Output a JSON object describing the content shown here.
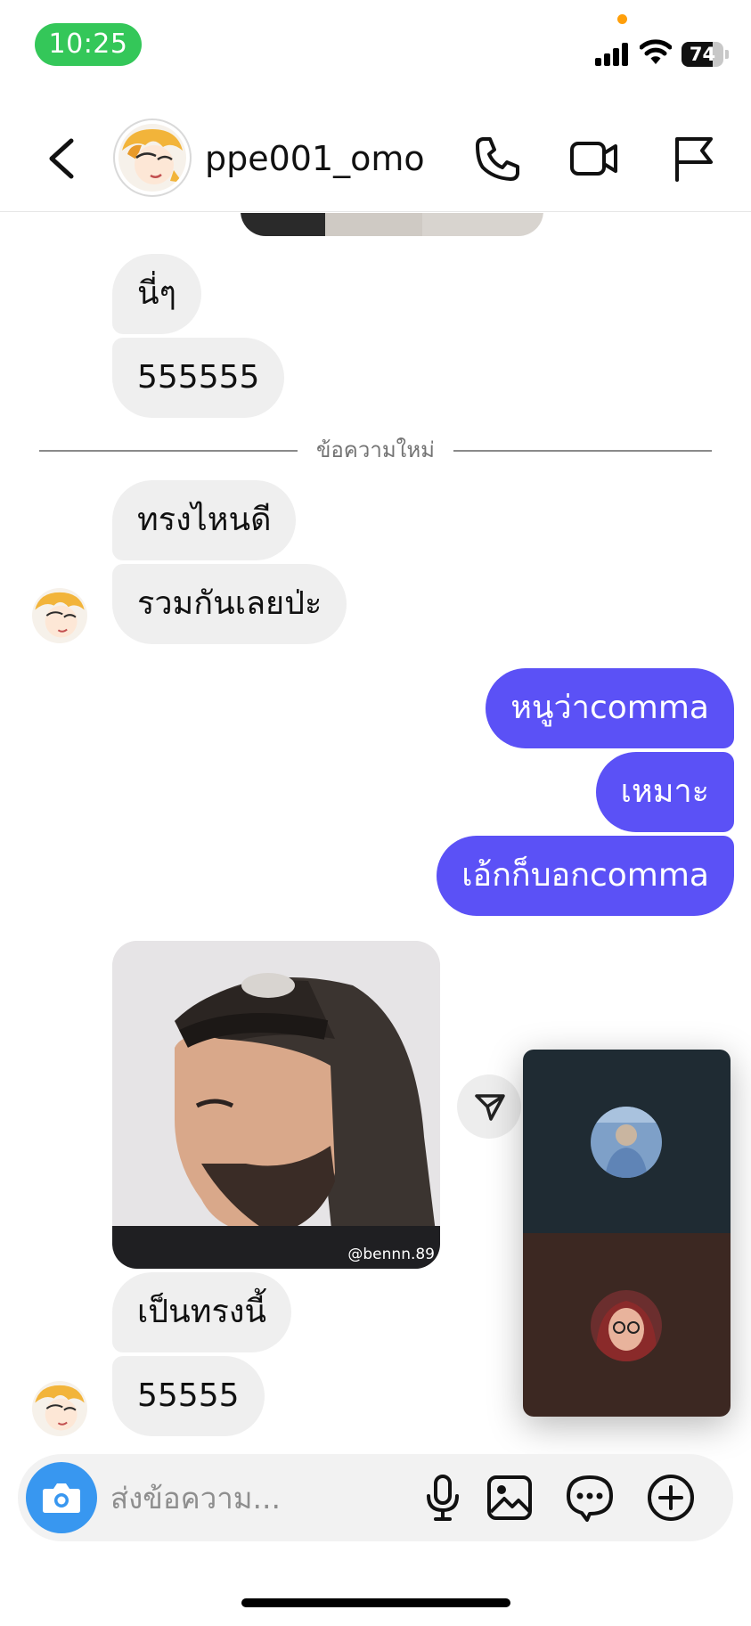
{
  "status_bar": {
    "time": "10:25",
    "battery": "74",
    "battery_level": 0.74
  },
  "header": {
    "username": "ppe001_omo",
    "icons": [
      "back-chevron-icon",
      "phone-icon",
      "video-camera-icon",
      "flag-icon"
    ]
  },
  "chat": {
    "old_messages": [
      {
        "text": "นี่ๆ"
      },
      {
        "text": "555555"
      }
    ],
    "divider_label": "ข้อความใหม่",
    "incoming_1": [
      {
        "text": "ทรงไหนดี"
      },
      {
        "text": "รวมกันเลยป่ะ"
      }
    ],
    "outgoing": [
      {
        "text": "หนูว่าcomma"
      },
      {
        "text": "เหมาะ"
      },
      {
        "text": "เอ้กก็บอกcomma"
      }
    ],
    "photo": {
      "watermark": "@bennn.89"
    },
    "incoming_2": [
      {
        "text": "เป็นทรงนี้"
      },
      {
        "text": "55555"
      }
    ]
  },
  "composer": {
    "placeholder": "ส่งข้อความ...",
    "icons": [
      "camera-icon",
      "microphone-icon",
      "gallery-icon",
      "sticker-icon",
      "plus-icon"
    ]
  },
  "colors": {
    "outgoing_bubble": "#5b51f6",
    "incoming_bubble": "#efefef",
    "camera_button": "#3897f0",
    "time_pill": "#34c759"
  }
}
